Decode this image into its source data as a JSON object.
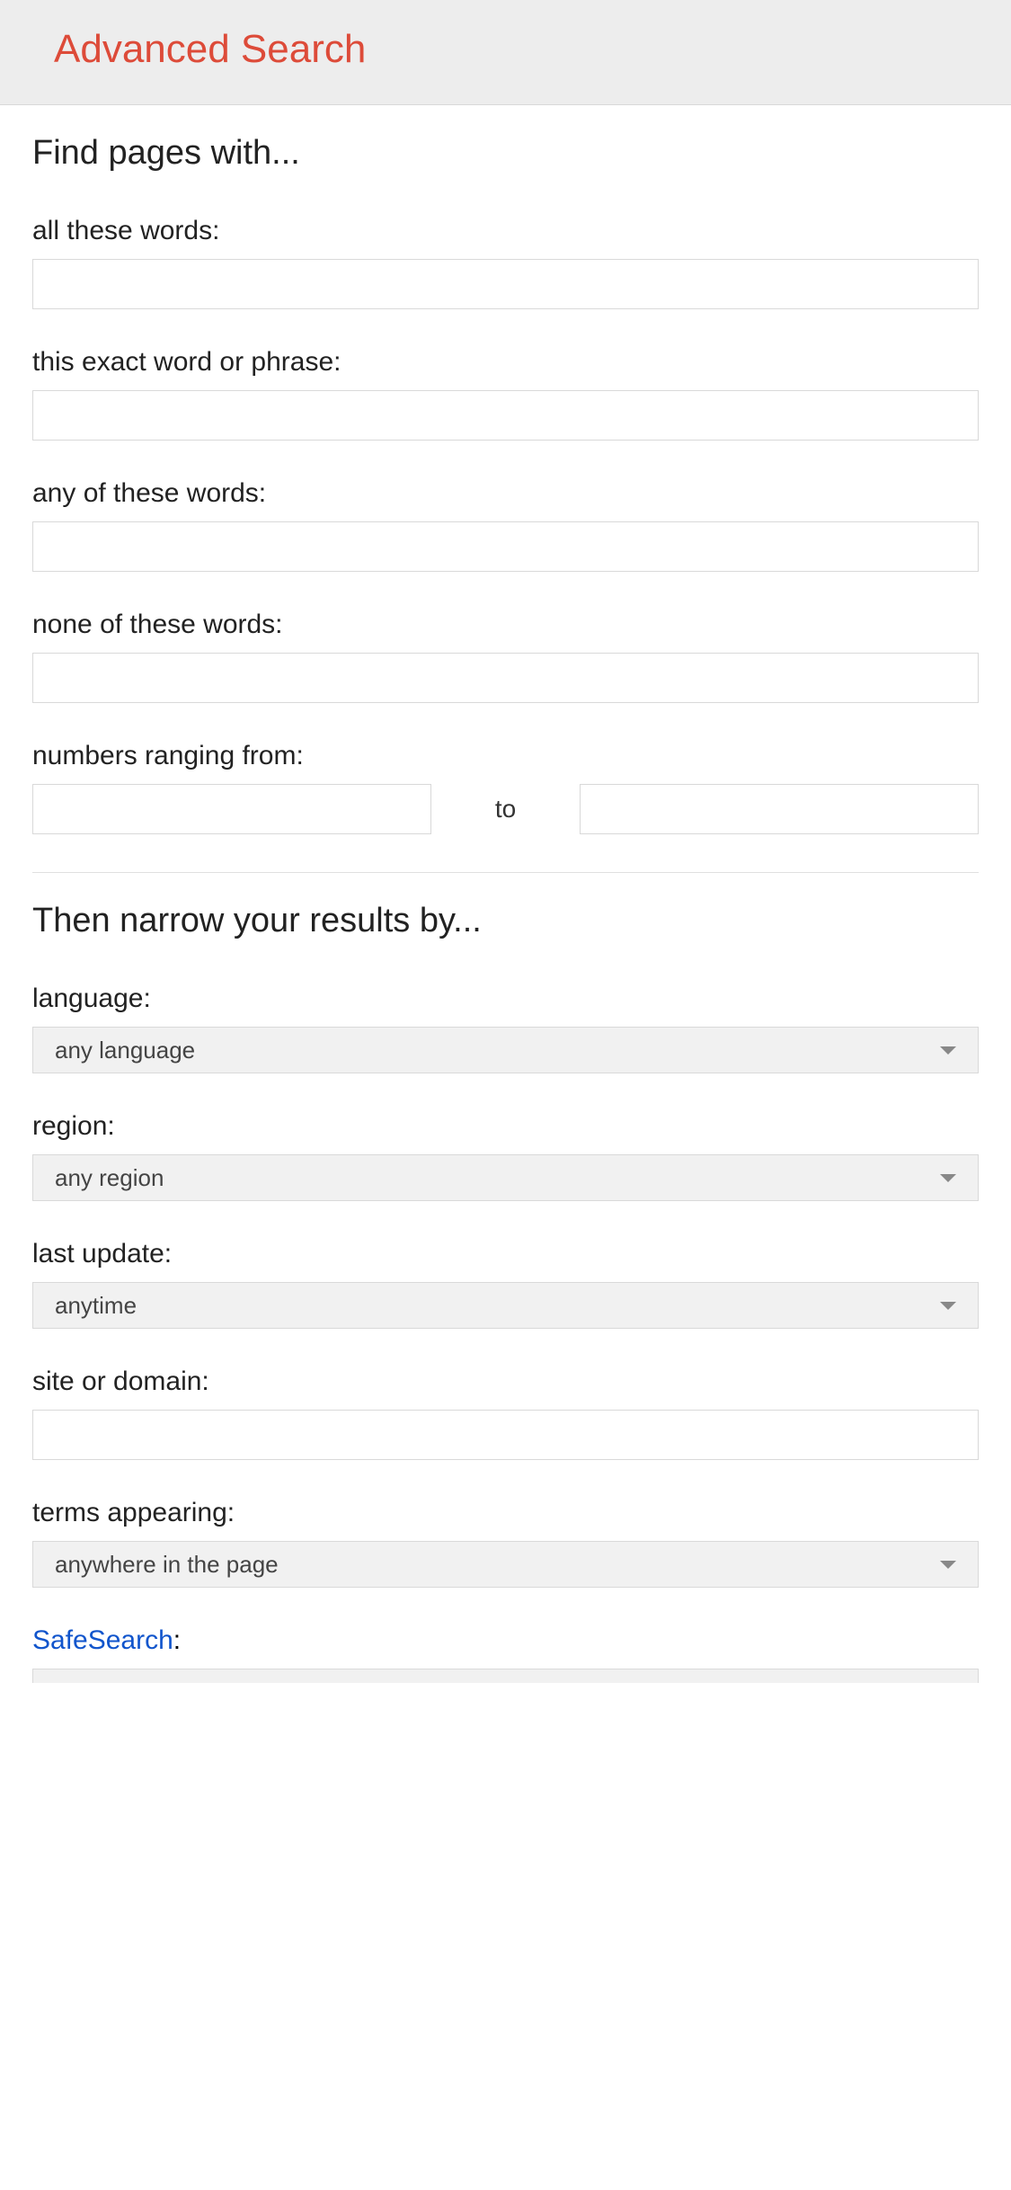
{
  "header": {
    "title": "Advanced Search"
  },
  "sections": {
    "find": "Find pages with...",
    "narrow": "Then narrow your results by..."
  },
  "fields": {
    "all_words": {
      "label": "all these words:",
      "value": ""
    },
    "exact_phrase": {
      "label": "this exact word or phrase:",
      "value": ""
    },
    "any_words": {
      "label": "any of these words:",
      "value": ""
    },
    "none_words": {
      "label": "none of these words:",
      "value": ""
    },
    "numbers_range": {
      "label": "numbers ranging from:",
      "from": "",
      "to_label": "to",
      "to": ""
    },
    "language": {
      "label": "language:",
      "value": "any language"
    },
    "region": {
      "label": "region:",
      "value": "any region"
    },
    "last_update": {
      "label": "last update:",
      "value": "anytime"
    },
    "site_domain": {
      "label": "site or domain:",
      "value": ""
    },
    "terms_appearing": {
      "label": "terms appearing:",
      "value": "anywhere in the page"
    },
    "safesearch": {
      "link_text": "SafeSearch",
      "colon": ":"
    }
  }
}
